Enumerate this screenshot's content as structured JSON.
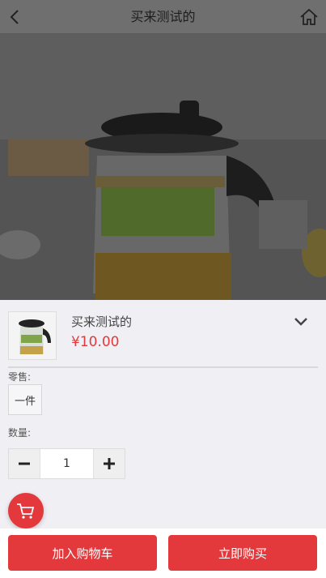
{
  "header": {
    "title": "买来测试的",
    "back_icon": "chevron-left-icon",
    "home_icon": "home-icon"
  },
  "product": {
    "name": "买来测试的",
    "price": "¥10.00"
  },
  "options": {
    "retail_label": "零售:",
    "retail_option": "一件"
  },
  "quantity": {
    "label": "数量:",
    "value": "1"
  },
  "actions": {
    "add_to_cart": "加入购物车",
    "buy_now": "立即购买"
  },
  "colors": {
    "accent": "#e4393c"
  }
}
